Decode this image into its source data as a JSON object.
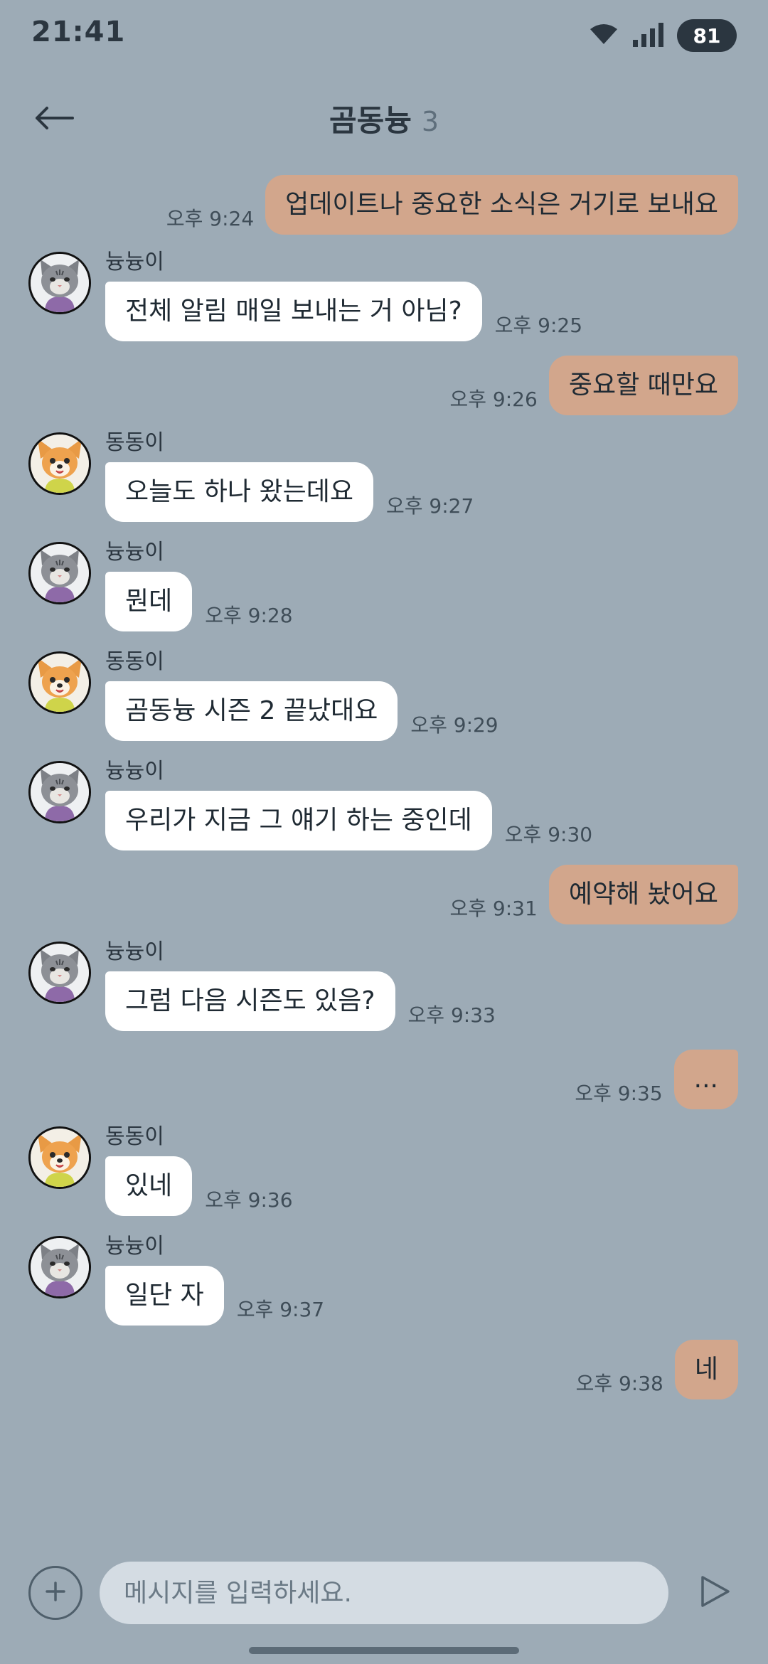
{
  "status_bar": {
    "time": "21:41",
    "battery": "81",
    "icons": [
      "wifi-icon",
      "signal-icon",
      "battery-icon"
    ]
  },
  "header": {
    "title": "곰동늉",
    "member_count": "3",
    "back_icon": "arrow-left-icon"
  },
  "messages": [
    {
      "side": "out",
      "text": "업데이트나 중요한 소식은 거기로 보내요",
      "time": "오후 9:24"
    },
    {
      "side": "in",
      "sender": "늉늉이",
      "avatar": "cat",
      "text": "전체 알림 매일 보내는 거 아님?",
      "time": "오후 9:25"
    },
    {
      "side": "out",
      "text": "중요할 때만요",
      "time": "오후 9:26"
    },
    {
      "side": "in",
      "sender": "동동이",
      "avatar": "dog",
      "text": "오늘도 하나 왔는데요",
      "time": "오후 9:27"
    },
    {
      "side": "in",
      "sender": "늉늉이",
      "avatar": "cat",
      "text": "뭔데",
      "time": "오후 9:28"
    },
    {
      "side": "in",
      "sender": "동동이",
      "avatar": "dog",
      "text": "곰동늉 시즌 2 끝났대요",
      "time": "오후 9:29"
    },
    {
      "side": "in",
      "sender": "늉늉이",
      "avatar": "cat",
      "text": "우리가 지금 그 얘기 하는 중인데",
      "time": "오후 9:30"
    },
    {
      "side": "out",
      "text": "예약해 놨어요",
      "time": "오후 9:31"
    },
    {
      "side": "in",
      "sender": "늉늉이",
      "avatar": "cat",
      "text": "그럼 다음 시즌도 있음?",
      "time": "오후 9:33"
    },
    {
      "side": "out",
      "text": "...",
      "time": "오후 9:35"
    },
    {
      "side": "in",
      "sender": "동동이",
      "avatar": "dog",
      "text": "있네",
      "time": "오후 9:36"
    },
    {
      "side": "in",
      "sender": "늉늉이",
      "avatar": "cat",
      "text": "일단 자",
      "time": "오후 9:37"
    },
    {
      "side": "out",
      "text": "네",
      "time": "오후 9:38"
    }
  ],
  "input": {
    "placeholder": "메시지를 입력하세요.",
    "value": "",
    "add_icon": "plus-icon",
    "send_icon": "send-icon"
  },
  "colors": {
    "background": "#9dabb6",
    "outgoing_bubble": "#d2a68c",
    "incoming_bubble": "#ffffff",
    "input_field": "#d4dce3"
  }
}
